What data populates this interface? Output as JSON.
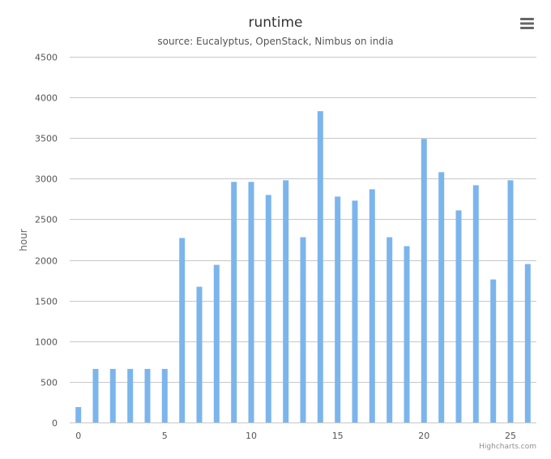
{
  "chart_data": {
    "type": "bar",
    "title": "runtime",
    "subtitle": "source: Eucalyptus, OpenStack, Nimbus on india",
    "ylabel": "hour",
    "xlabel": "",
    "ylim": [
      0,
      4500
    ],
    "xlim": [
      -0.5,
      26.5
    ],
    "yticks": [
      0,
      500,
      1000,
      1500,
      2000,
      2500,
      3000,
      3500,
      4000,
      4500
    ],
    "xticks": [
      0,
      5,
      10,
      15,
      20,
      25
    ],
    "x": [
      0,
      1,
      2,
      3,
      4,
      5,
      6,
      7,
      8,
      9,
      10,
      11,
      12,
      13,
      14,
      15,
      16,
      17,
      18,
      19,
      20,
      21,
      22,
      23,
      24,
      25,
      26
    ],
    "values": [
      190,
      660,
      660,
      660,
      660,
      660,
      2270,
      1670,
      1940,
      2960,
      2960,
      2800,
      2980,
      2280,
      3830,
      2780,
      2730,
      2870,
      2280,
      2170,
      3490,
      3080,
      2610,
      2920,
      1760,
      2980,
      1950
    ],
    "grid": true,
    "color": "#7cb5ec",
    "credits": "Highcharts.com"
  },
  "menu": {
    "icon": "hamburger-menu-icon"
  }
}
